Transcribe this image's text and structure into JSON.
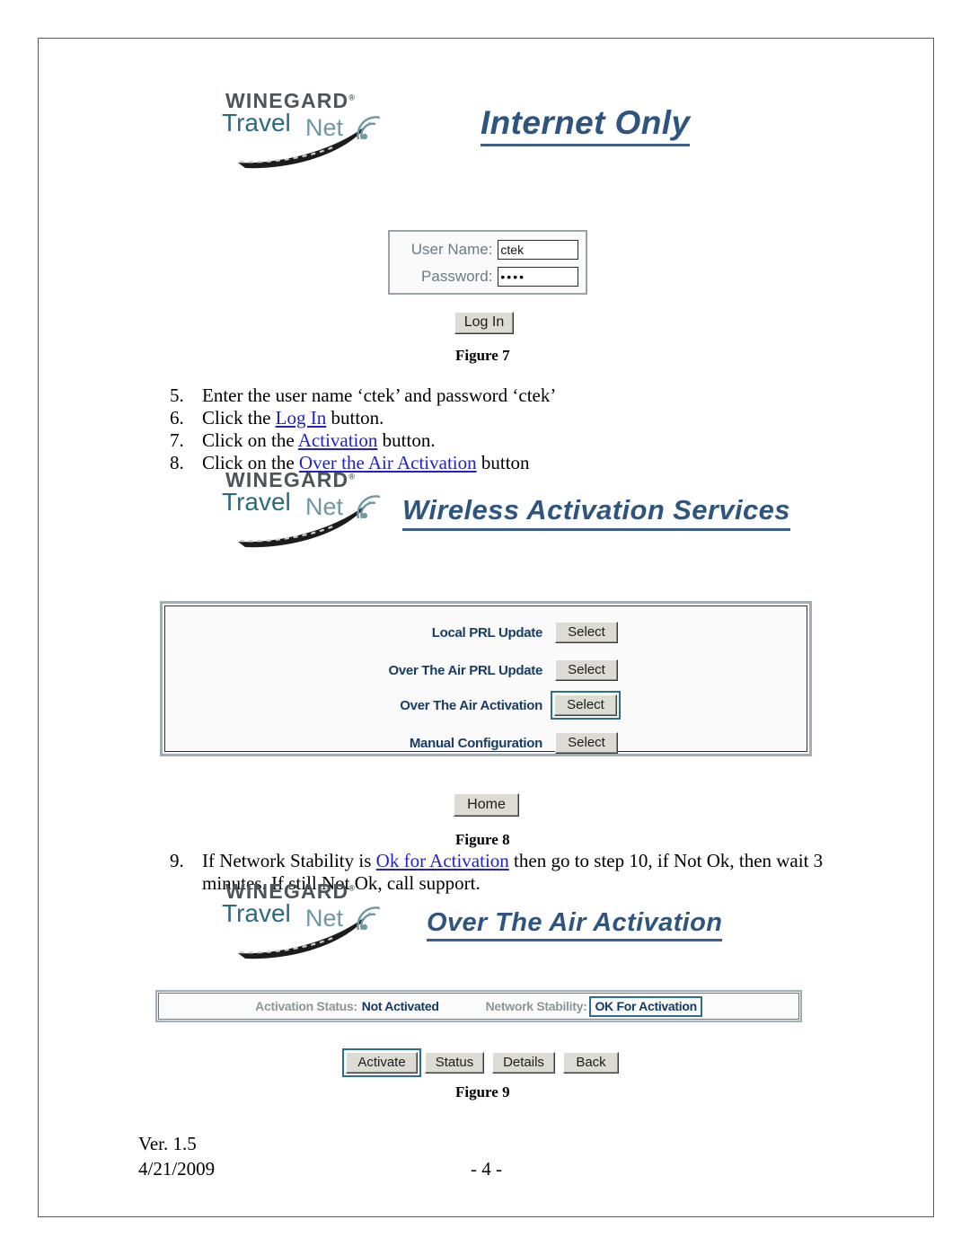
{
  "document": {
    "page_number_label": "- 4 -",
    "version": "Ver. 1.5",
    "date": "4/21/2009"
  },
  "brand": {
    "company": "WINEGARD",
    "registered_mark": "®",
    "product_word_1": "Travel",
    "product_word_2": "Net"
  },
  "figure7": {
    "heading": "Internet Only",
    "caption": "Figure 7",
    "form": {
      "username_label": "User Name:",
      "username_value": "ctek",
      "password_label": "Password:",
      "password_value": "••••",
      "login_button": "Log In"
    }
  },
  "steps_group_1": [
    {
      "num": "5.",
      "pre": "Enter the user name ‘ctek’ and password ‘ctek’",
      "link": "",
      "post": ""
    },
    {
      "num": "6.",
      "pre": "Click the ",
      "link": "Log In",
      "post": " button."
    },
    {
      "num": "7.",
      "pre": "Click on the ",
      "link": "Activation",
      "post": " button."
    },
    {
      "num": "8.",
      "pre": "Click on the ",
      "link": "Over the Air Activation",
      "post": " button"
    }
  ],
  "figure8": {
    "heading": "Wireless Activation Services",
    "caption": "Figure 8",
    "home_button": "Home",
    "options": [
      {
        "label": "Local PRL Update",
        "button": "Select",
        "focused": false
      },
      {
        "label": "Over The Air PRL Update",
        "button": "Select",
        "focused": false
      },
      {
        "label": "Over The Air Activation",
        "button": "Select",
        "focused": true
      },
      {
        "label": "Manual Configuration",
        "button": "Select",
        "focused": false
      }
    ]
  },
  "step9": {
    "num": "9.",
    "pre": "If Network Stability is ",
    "link": "Ok for Activation",
    "post": " then go to step 10, if Not Ok, then wait 3",
    "line2": "minutes.  If still Not Ok, call support."
  },
  "figure9": {
    "heading": "Over The Air Activation",
    "caption": "Figure 9",
    "status": {
      "activation_status_label": "Activation Status:",
      "activation_status_value": "Not Activated",
      "network_stability_label": "Network Stability:",
      "network_stability_value": "OK For Activation"
    },
    "buttons": [
      {
        "label": "Activate",
        "focused": true
      },
      {
        "label": "Status",
        "focused": false
      },
      {
        "label": "Details",
        "focused": false
      },
      {
        "label": "Back",
        "focused": false
      }
    ]
  },
  "colors": {
    "heading_blue": "#2e5580",
    "link_blue": "#2222cc",
    "panel_label_blue": "#173d66",
    "focus_border": "#2d6e8e",
    "brand_gray": "#4b555a",
    "brand_travel": "#2b6b80",
    "brand_net": "#6f98a6"
  }
}
